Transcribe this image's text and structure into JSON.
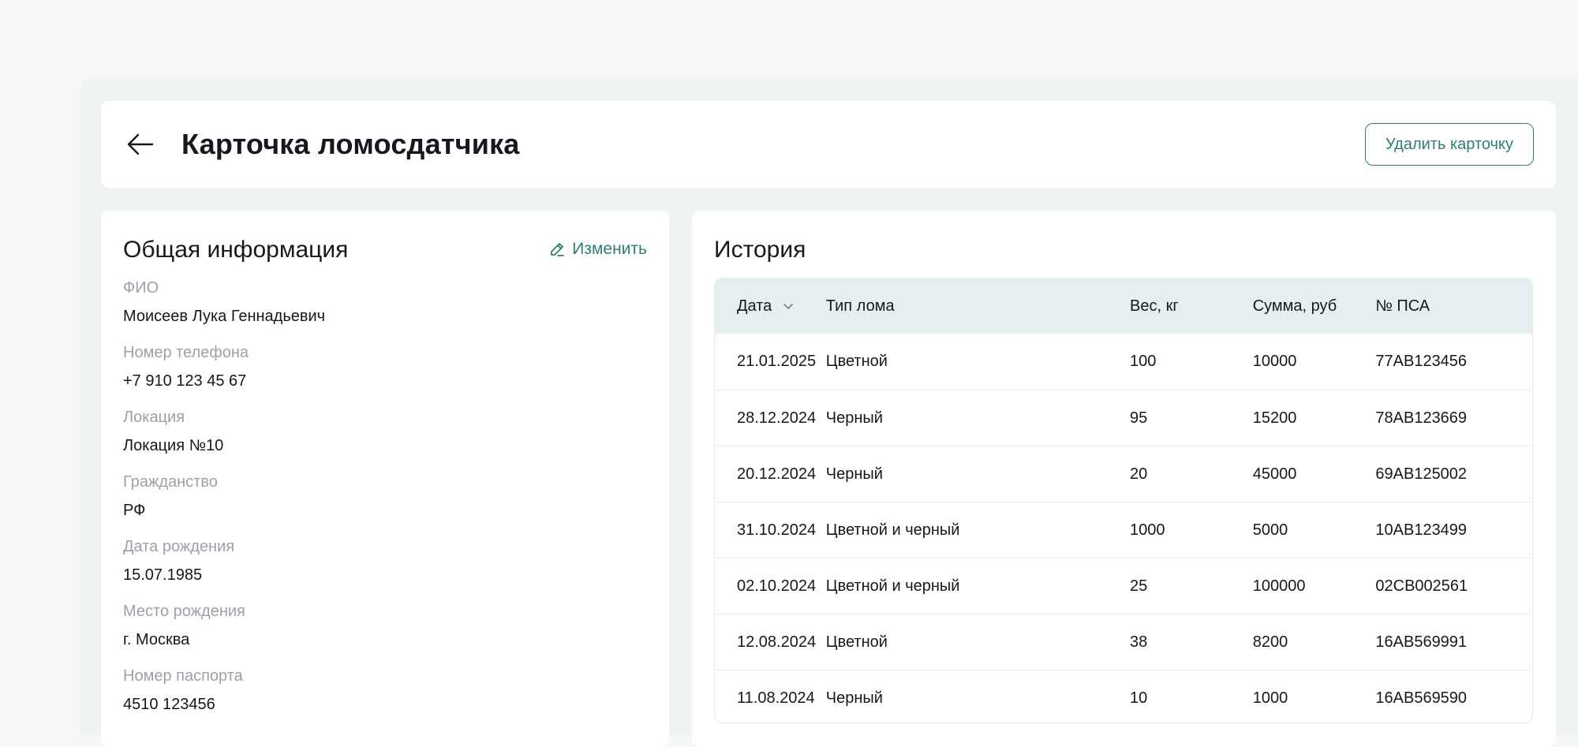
{
  "header": {
    "title": "Карточка ломосдатчика",
    "delete_label": "Удалить карточку"
  },
  "general": {
    "title": "Общая информация",
    "edit_label": "Изменить",
    "fields": [
      {
        "label": "ФИО",
        "value": "Моисеев Лука Геннадьевич"
      },
      {
        "label": "Номер телефона",
        "value": "+7 910 123 45 67"
      },
      {
        "label": "Локация",
        "value": "Локация №10"
      },
      {
        "label": "Гражданство",
        "value": "РФ"
      },
      {
        "label": "Дата рождения",
        "value": "15.07.1985"
      },
      {
        "label": "Место рождения",
        "value": "г. Москва"
      },
      {
        "label": "Номер паспорта",
        "value": "4510 123456"
      }
    ]
  },
  "history": {
    "title": "История",
    "columns": {
      "date": "Дата",
      "type": "Тип лома",
      "weight": "Вес, кг",
      "sum": "Сумма, руб",
      "psa": "№ ПСА"
    },
    "rows": [
      {
        "date": "21.01.2025",
        "type": "Цветной",
        "weight": "100",
        "sum": "10000",
        "psa": "77AB123456"
      },
      {
        "date": "28.12.2024",
        "type": "Черный",
        "weight": "95",
        "sum": "15200",
        "psa": "78AB123669"
      },
      {
        "date": "20.12.2024",
        "type": "Черный",
        "weight": "20",
        "sum": "45000",
        "psa": "69AB125002"
      },
      {
        "date": "31.10.2024",
        "type": "Цветной и черный",
        "weight": "1000",
        "sum": "5000",
        "psa": "10AB123499"
      },
      {
        "date": "02.10.2024",
        "type": "Цветной и черный",
        "weight": "25",
        "sum": "100000",
        "psa": "02CB002561"
      },
      {
        "date": "12.08.2024",
        "type": "Цветной",
        "weight": "38",
        "sum": "8200",
        "psa": "16AB569991"
      },
      {
        "date": "11.08.2024",
        "type": "Черный",
        "weight": "10",
        "sum": "1000",
        "psa": "16AB569590"
      }
    ]
  },
  "colors": {
    "accent": "#2e7d6f",
    "page_bg": "#f6f7f9",
    "frame_bg": "#eff4f3",
    "table_header_bg": "#e6efef"
  },
  "icons": {
    "back": "arrow-left-icon",
    "edit": "pencil-icon",
    "sort": "chevron-down-icon"
  }
}
